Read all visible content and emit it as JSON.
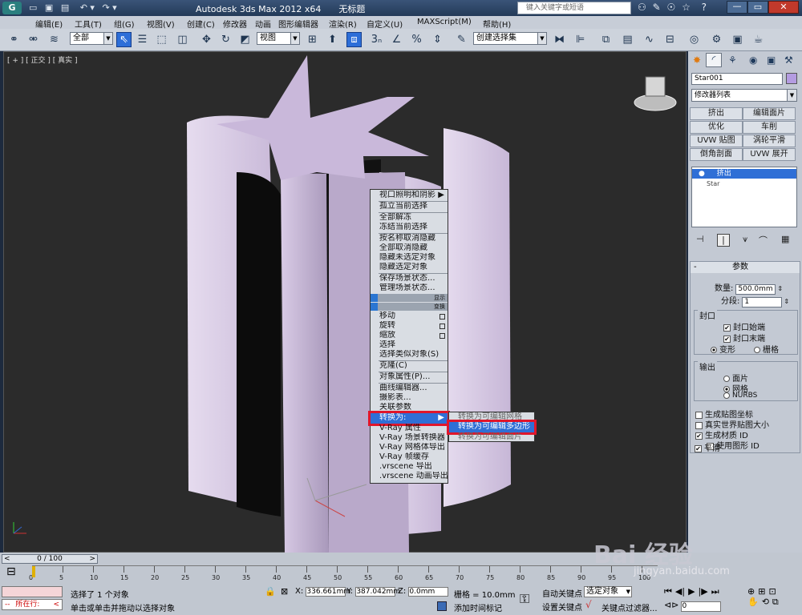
{
  "window": {
    "title": "Autodesk 3ds Max  2012 x64",
    "file": "无标题",
    "search_placeholder": "键入关键字或短语"
  },
  "menus": [
    "编辑(E)",
    "工具(T)",
    "组(G)",
    "视图(V)",
    "创建(C)",
    "修改器",
    "动画",
    "图形编辑器",
    "渲染(R)",
    "自定义(U)",
    "MAXScript(M)",
    "帮助(H)"
  ],
  "toolbar": {
    "filter": "全部",
    "ref_coord": "视图",
    "selection_set": "创建选择集"
  },
  "viewport": {
    "label": "[ + ] [ 正交 ] [ 真实 ]"
  },
  "context_menu": {
    "items_a": [
      "视口照明和阴影",
      "孤立当前选择",
      "全部解冻",
      "冻结当前选择",
      "按名称取消隐藏",
      "全部取消隐藏",
      "隐藏未选定对象",
      "隐藏选定对象",
      "保存场景状态...",
      "管理场景状态..."
    ],
    "header_display": "显示",
    "header_transform": "变换",
    "items_b": [
      "移动",
      "旋转",
      "缩放",
      "选择",
      "选择类似对象(S)",
      "克隆(C)",
      "对象属性(P)...",
      "曲线编辑器...",
      "摄影表...",
      "关联参数",
      "转换为:",
      "V-Ray 属性",
      "V-Ray 场景转换器",
      "V-Ray 网格体导出",
      "V-Ray 帧缓存",
      ".vrscene 导出",
      ".vrscene 动画导出"
    ]
  },
  "submenu": {
    "items": [
      "转换为可编辑网格",
      "转换为可编辑多边形",
      "转换为可编辑面片"
    ]
  },
  "cmdpanel": {
    "object_name": "Star001",
    "modifier_list": "修改器列表",
    "mod_buttons": [
      "挤出",
      "编辑面片",
      "优化",
      "车削",
      "UVW 贴图",
      "涡轮平滑",
      "倒角剖面",
      "UVW 展开"
    ],
    "stack": [
      "挤出",
      "Star"
    ],
    "params": {
      "title": "参数",
      "amount_label": "数量:",
      "amount_value": "500.0mm",
      "segments_label": "分段:",
      "segments_value": "1",
      "capping_label": "封口",
      "cap_start": "封口始端",
      "cap_end": "封口末端",
      "morph": "变形",
      "grid": "栅格",
      "output_label": "输出",
      "patch": "面片",
      "mesh": "网格",
      "nurbs": "NURBS",
      "gen_map_coords": "生成贴图坐标",
      "real_world": "真实世界贴图大小",
      "gen_mat_ids": "生成材质 ID",
      "use_shape_ids": "使用图形 ID",
      "smooth": "平滑"
    }
  },
  "timeline": {
    "frame": "0 / 100",
    "ticks": [
      "0",
      "5",
      "10",
      "15",
      "20",
      "25",
      "30",
      "35",
      "40",
      "45",
      "50",
      "55",
      "60",
      "65",
      "70",
      "75",
      "80",
      "85",
      "90",
      "95",
      "100"
    ],
    "status_selected": "选择了 1 个对象",
    "status_hint": "单击或单击并拖动以选择对象",
    "coord_x": "336.661mm",
    "coord_y": "387.042mm",
    "coord_z": "0.0mm",
    "grid": "栅格 = 10.0mm",
    "auto_key": "自动关键点",
    "set_key": "设置关键点",
    "key_filter_sel": "选定对象",
    "key_filters": "关键点过滤器...",
    "add_time_tag": "添加时间标记",
    "maxscript_line": "所在行:",
    "frame_field": "0",
    "watermark_brand": "Bai  经验",
    "watermark_url": "jingyan.baidu.com"
  }
}
